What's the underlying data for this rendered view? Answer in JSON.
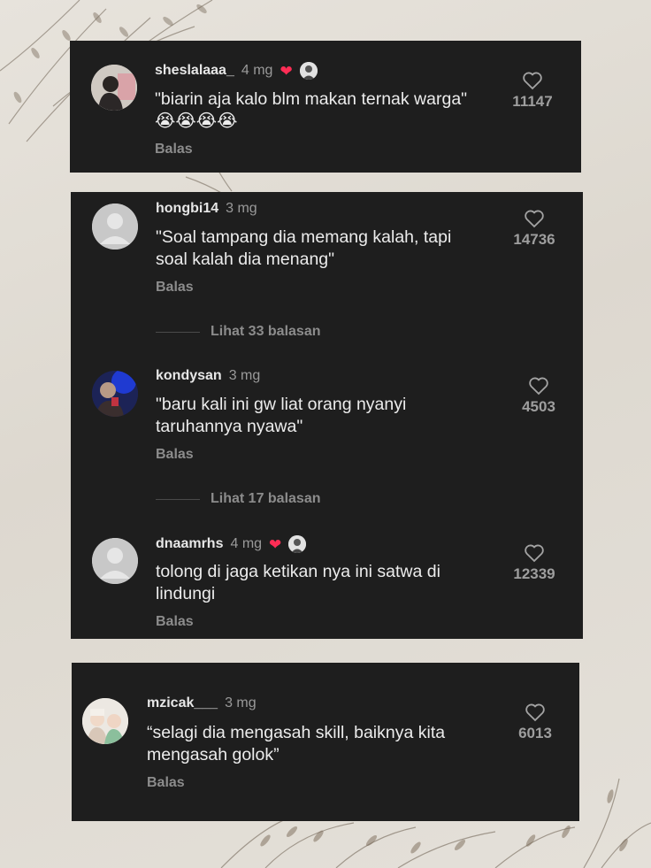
{
  "colors": {
    "card_bg": "#1e1e1e",
    "heart_red": "#ff2d55",
    "page_bg": "#e4e0d9"
  },
  "comments": [
    {
      "username": "sheslalaaa_",
      "time": "4 mg",
      "text1": "\"biarin aja kalo blm makan ternak warga\"",
      "emoji": "😭😭😭😭",
      "reply": "Balas",
      "likes": "11147",
      "liked_by_creator": true
    },
    {
      "username": "hongbi14",
      "time": "3 mg",
      "text1": "\"Soal tampang dia memang kalah, tapi",
      "text2": "soal kalah dia menang\"",
      "reply": "Balas",
      "likes": "14736",
      "view_replies": "Lihat 33 balasan"
    },
    {
      "username": "kondysan",
      "time": "3 mg",
      "text1": "\"baru kali ini gw liat orang nyanyi",
      "text2": "taruhannya nyawa\"",
      "reply": "Balas",
      "likes": "4503",
      "view_replies": "Lihat 17 balasan"
    },
    {
      "username": "dnaamrhs",
      "time": "4 mg",
      "text1": "tolong di jaga ketikan nya ini satwa di",
      "text2": "lindungi",
      "reply": "Balas",
      "likes": "12339",
      "liked_by_creator": true
    },
    {
      "username": "mzicak___",
      "time": "3 mg",
      "text1": "“selagi dia mengasah skill, baiknya kita",
      "text2": "mengasah golok”",
      "reply": "Balas",
      "likes": "6013"
    }
  ]
}
